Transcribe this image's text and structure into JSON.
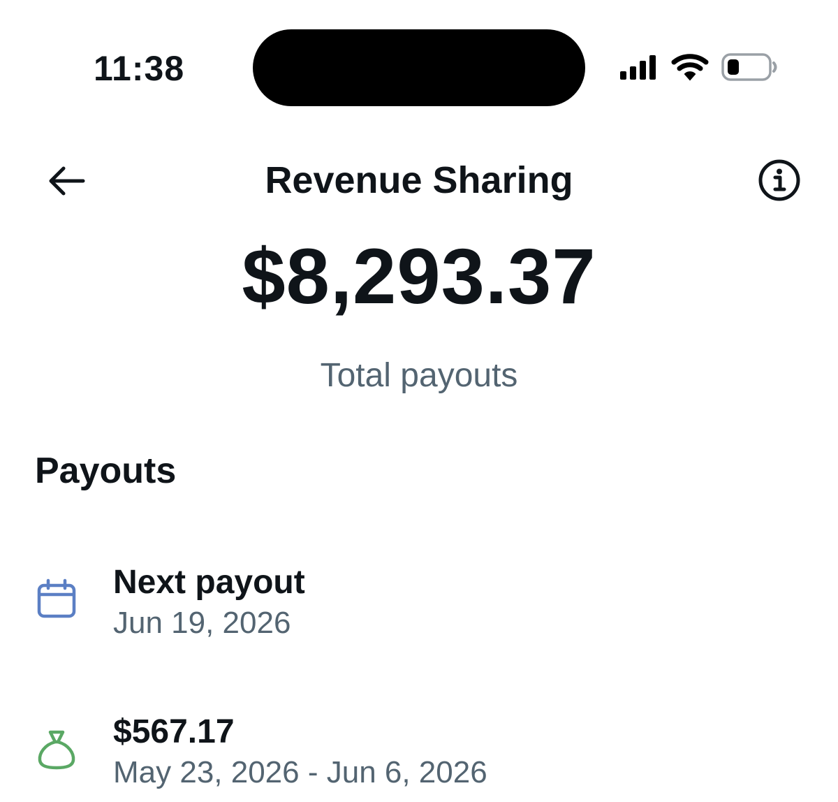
{
  "status_bar": {
    "time": "11:38",
    "signal_icon": "cellular-signal-icon",
    "wifi_icon": "wifi-icon",
    "battery_icon": "battery-icon",
    "battery_level_fraction": 0.25
  },
  "header": {
    "title": "Revenue Sharing",
    "back_icon": "arrow-left-icon",
    "info_icon": "info-circle-icon"
  },
  "summary": {
    "total_amount": "$8,293.37",
    "total_label": "Total payouts"
  },
  "payouts": {
    "heading": "Payouts",
    "items": [
      {
        "icon": "calendar-icon",
        "icon_color": "#5b7fc4",
        "title": "Next payout",
        "subtitle": "Jun 19, 2026"
      },
      {
        "icon": "money-bag-icon",
        "icon_color": "#5aa864",
        "title": "$567.17",
        "subtitle": "May 23, 2026 - Jun 6, 2026"
      }
    ]
  },
  "colors": {
    "text_primary": "#0f1419",
    "text_secondary": "#536471",
    "background": "#ffffff"
  }
}
